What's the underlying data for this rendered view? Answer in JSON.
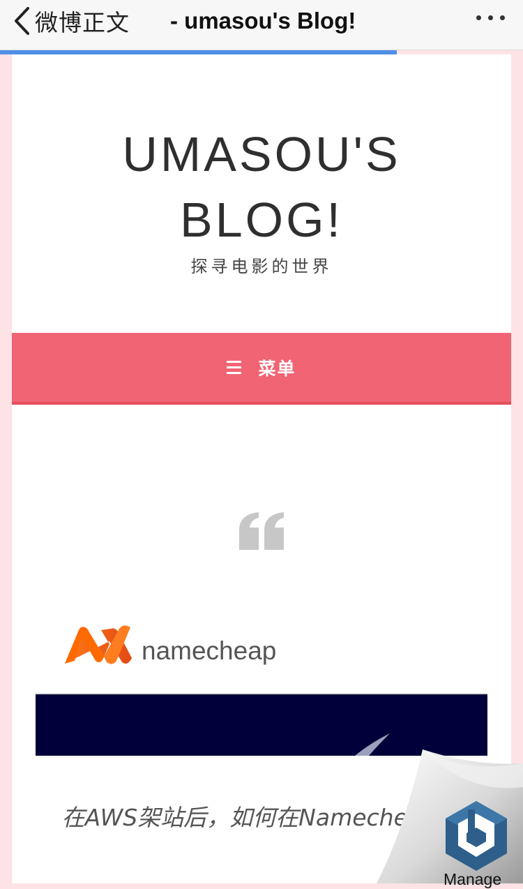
{
  "navbar": {
    "back_label": "微博正文",
    "title": "- umasou's Blog!"
  },
  "site": {
    "title_line1": "UMASOU'S",
    "title_line2": "BLOG!",
    "tagline": "探寻电影的世界"
  },
  "menu": {
    "label": "菜单"
  },
  "post": {
    "logo_text": "namecheap",
    "title": "在AWS架站后，如何在Nameche 域名"
  },
  "overlay": {
    "manage_label": "Manage"
  },
  "colors": {
    "menu_bar": "#f16474",
    "progress": "#4f8fe6",
    "hero_bg": "#01003a",
    "page_bg": "#fde2e6"
  }
}
